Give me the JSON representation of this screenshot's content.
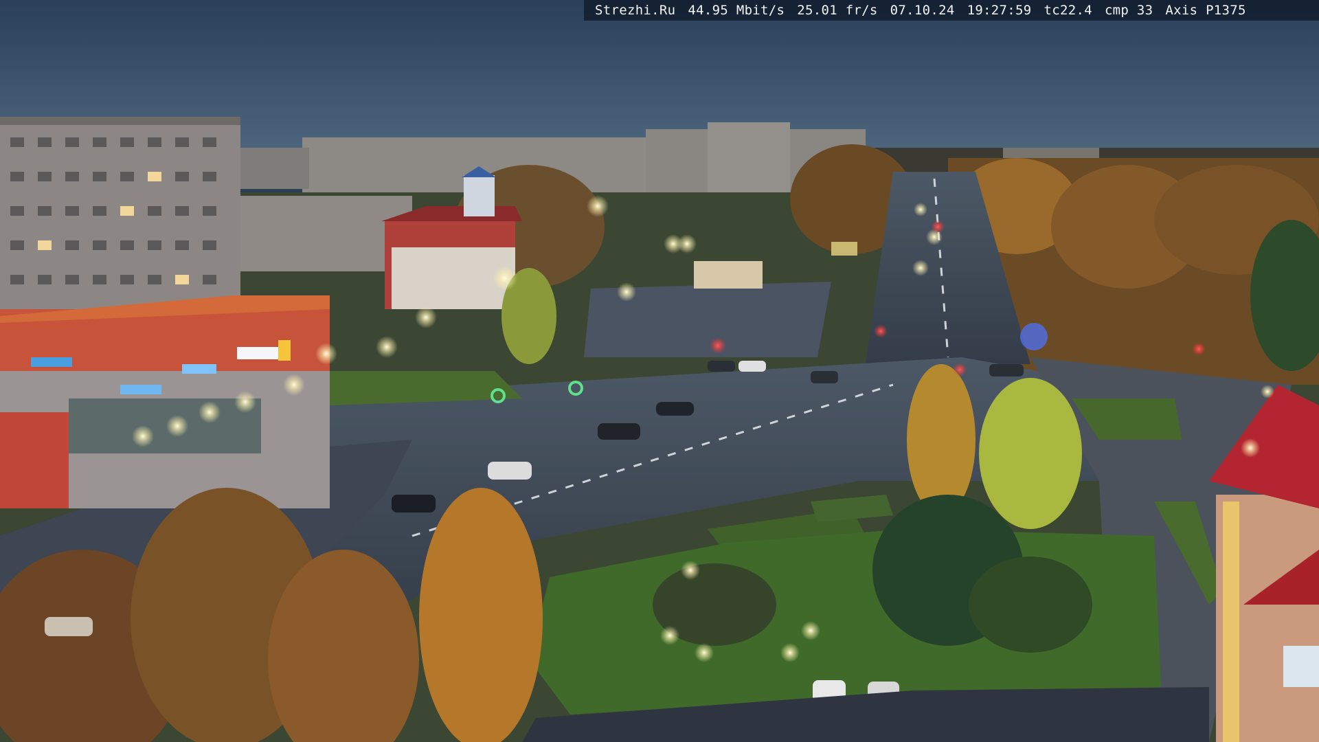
{
  "overlay": {
    "site": "Strezhi.Ru",
    "bitrate": "44.95 Mbit/s",
    "fps": "25.01 fr/s",
    "date": "07.10.24",
    "time": "19:27:59",
    "tc": "tc22.4",
    "cmp": "cmp 33",
    "camera": "Axis P1375"
  },
  "colors": {
    "sky_top": "#2b3f5a",
    "sky_bottom": "#4f6b87",
    "road": "#3f4a58",
    "grass": "#3f6a2a",
    "building": "#8f8c8c",
    "autumn_tree": "#b5782a",
    "red_building": "#b54a3a",
    "street_light": "#f6f2cf"
  }
}
